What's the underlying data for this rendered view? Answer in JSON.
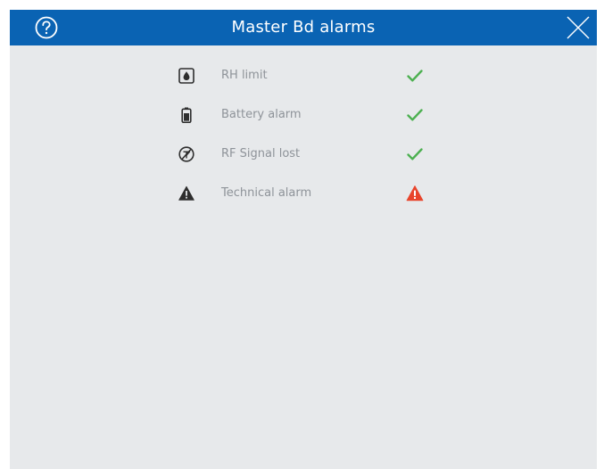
{
  "header": {
    "title": "Master Bd alarms",
    "help_icon": "help-circle-icon",
    "close_icon": "close-icon",
    "background_color": "#0a63b3"
  },
  "alarms": [
    {
      "label": "RH limit",
      "icon": "humidity-drop-icon",
      "status": "ok",
      "status_icon": "checkmark-icon"
    },
    {
      "label": "Battery alarm",
      "icon": "battery-icon",
      "status": "ok",
      "status_icon": "checkmark-icon"
    },
    {
      "label": "RF Signal lost",
      "icon": "signal-lost-icon",
      "status": "ok",
      "status_icon": "checkmark-icon"
    },
    {
      "label": "Technical alarm",
      "icon": "warning-triangle-icon",
      "status": "alarm",
      "status_icon": "alarm-triangle-icon"
    }
  ],
  "colors": {
    "ok": "#4cb050",
    "alarm": "#e8452c",
    "label": "#8e9399",
    "panel": "#e7e9eb"
  }
}
